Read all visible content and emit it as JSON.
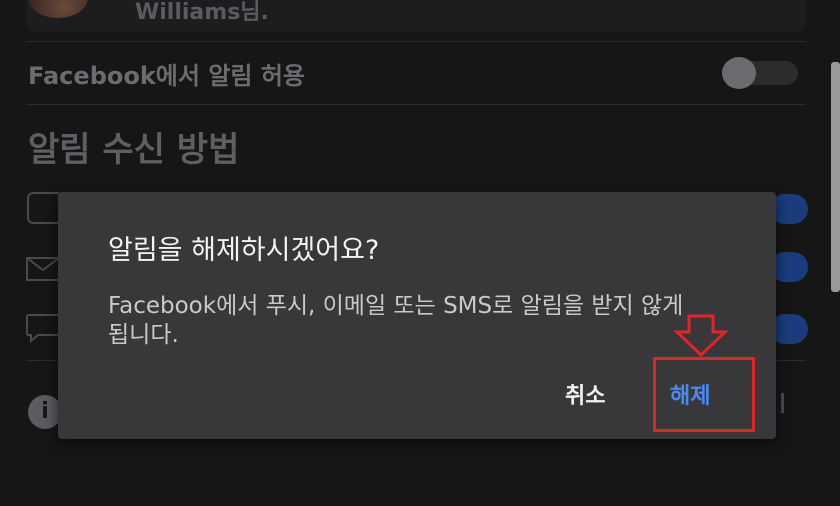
{
  "profile": {
    "name": "Williams님."
  },
  "settings": {
    "allow_label": "Facebook에서 알림 허용",
    "allow_enabled": false,
    "section_title": "알림 수신 방법",
    "channels": [
      {
        "icon": "push-icon",
        "enabled": true
      },
      {
        "icon": "email-icon",
        "enabled": true
      },
      {
        "icon": "sms-icon",
        "enabled": true
      }
    ]
  },
  "dialog": {
    "title": "알림을 해제하시겠어요?",
    "message": "Facebook에서 푸시, 이메일 또는 SMS로 알림을 받지 않게 됩니다.",
    "cancel_label": "취소",
    "confirm_label": "해제"
  },
  "annotation": {
    "color": "#e1242a"
  },
  "colors": {
    "accent": "#4a8af4",
    "toggle_on": "#1b3c7c"
  }
}
